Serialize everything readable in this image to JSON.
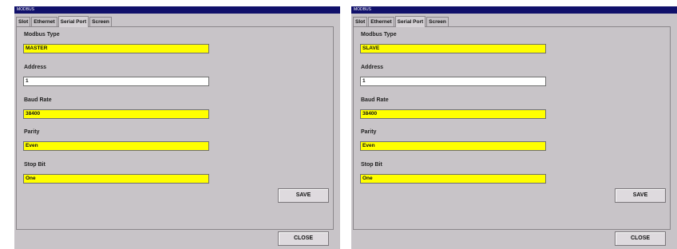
{
  "windows": [
    {
      "title": "MODBUS",
      "tabs": [
        "Slot",
        "Ethernet",
        "Serial Port",
        "Screen"
      ],
      "active_tab": "Serial Port",
      "fields": {
        "modbus_type": {
          "label": "Modbus Type",
          "value": "MASTER"
        },
        "address": {
          "label": "Address",
          "value": "1"
        },
        "baud_rate": {
          "label": "Baud Rate",
          "value": "38400"
        },
        "parity": {
          "label": "Parity",
          "value": "Even"
        },
        "stop_bit": {
          "label": "Stop Bit",
          "value": "One"
        }
      },
      "save_label": "SAVE",
      "close_label": "CLOSE"
    },
    {
      "title": "MODBUS",
      "tabs": [
        "Slot",
        "Ethernet",
        "Serial Port",
        "Screen"
      ],
      "active_tab": "Serial Port",
      "fields": {
        "modbus_type": {
          "label": "Modbus Type",
          "value": "SLAVE"
        },
        "address": {
          "label": "Address",
          "value": "1"
        },
        "baud_rate": {
          "label": "Baud Rate",
          "value": "38400"
        },
        "parity": {
          "label": "Parity",
          "value": "Even"
        },
        "stop_bit": {
          "label": "Stop Bit",
          "value": "One"
        }
      },
      "save_label": "SAVE",
      "close_label": "CLOSE"
    }
  ],
  "colors": {
    "titlebar": "#10106a",
    "window_bg": "#c8c4c8",
    "field_highlight": "#ffff00",
    "field_plain": "#ffffff"
  }
}
